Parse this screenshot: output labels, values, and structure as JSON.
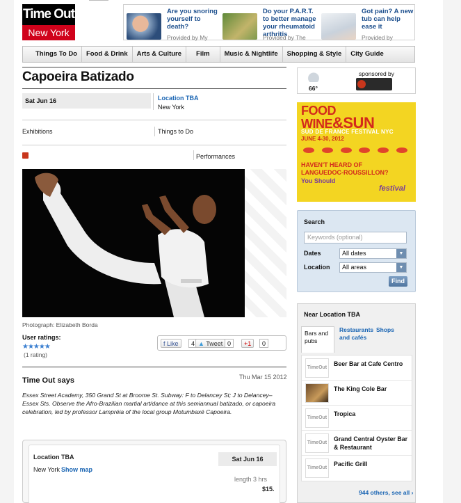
{
  "brand": {
    "line1": "Time Out",
    "line2": "New York"
  },
  "ads": [
    {
      "text": "Are you snoring yourself to death?",
      "provider": "Provided by My"
    },
    {
      "text": "Do your P.A.R.T. to better manage your rheumatoid arthritis",
      "provider": "Provided by The"
    },
    {
      "text": "Got pain? A new tub can help ease it",
      "provider": "Provided by"
    }
  ],
  "nav": [
    "Things To Do",
    "Food & Drink",
    "Arts & Culture",
    "Film",
    "Music & Nightlife",
    "Shopping & Style",
    "City Guide"
  ],
  "event": {
    "title": "Capoeira Batizado",
    "date": "Sat Jun 16",
    "location_link": "Location TBA",
    "city": "New York",
    "category1": "Exhibitions",
    "category2": "Things to Do",
    "category3": "Performances",
    "photo_credit": "Photograph: Elizabeth Borda",
    "ratings_label": "User ratings:",
    "stars": "★★★★★",
    "rating_count": "(1 rating)"
  },
  "social": {
    "like": "Like",
    "like_count": "4",
    "tweet": "Tweet",
    "tweet_count": "0",
    "plus_count": "0"
  },
  "review": {
    "heading": "Time Out says",
    "date": "Thu Mar 15 2012",
    "text": "Essex Street Academy, 350 Grand St at Broome St. Subway: F to Delancey St; J to Delancey–Essex Sts. Observe the Afro-Brazilian martial art/dance at this semiannual batizado, or capoeira celebration, led by professor Lampréia of the local group Motumbaxé Capoeira."
  },
  "info": {
    "location": "Location TBA",
    "city": "New York",
    "show_map": "Show map",
    "date": "Sat Jun 16",
    "length": "length 3 hrs",
    "price": "$15."
  },
  "weather": {
    "temp": "66°",
    "sponsored": "sponsored by"
  },
  "promo": {
    "headline1": "FOOD",
    "headline2": "WINE",
    "amp": "&SUN",
    "sub": "SUD DE FRANCE FESTIVAL NYC",
    "dates": "JUNE 4-30, 2012",
    "question": "HAVEN'T HEARD OF LANGUEDOC-ROUSSILLON?",
    "answer": "You Should",
    "festival": "festival"
  },
  "search": {
    "heading": "Search",
    "keywords_placeholder": "Keywords (optional)",
    "dates_label": "Dates",
    "dates_value": "All dates",
    "location_label": "Location",
    "location_value": "All areas",
    "find": "Find"
  },
  "near": {
    "heading": "Near Location TBA",
    "tabs": [
      "Bars and pubs",
      "Restaurants and cafés",
      "Shops"
    ],
    "items": [
      "Beer Bar at Cafe Centro",
      "The King Cole Bar",
      "Tropica",
      "Grand Central Oyster Bar & Restaurant",
      "Pacific Grill"
    ],
    "thumb_label": "TimeOut",
    "more": "944 others, see all ›"
  },
  "colors": {
    "accent_red": "#d0021b",
    "link_blue": "#1a65b3",
    "search_bg": "#dce7f2"
  }
}
